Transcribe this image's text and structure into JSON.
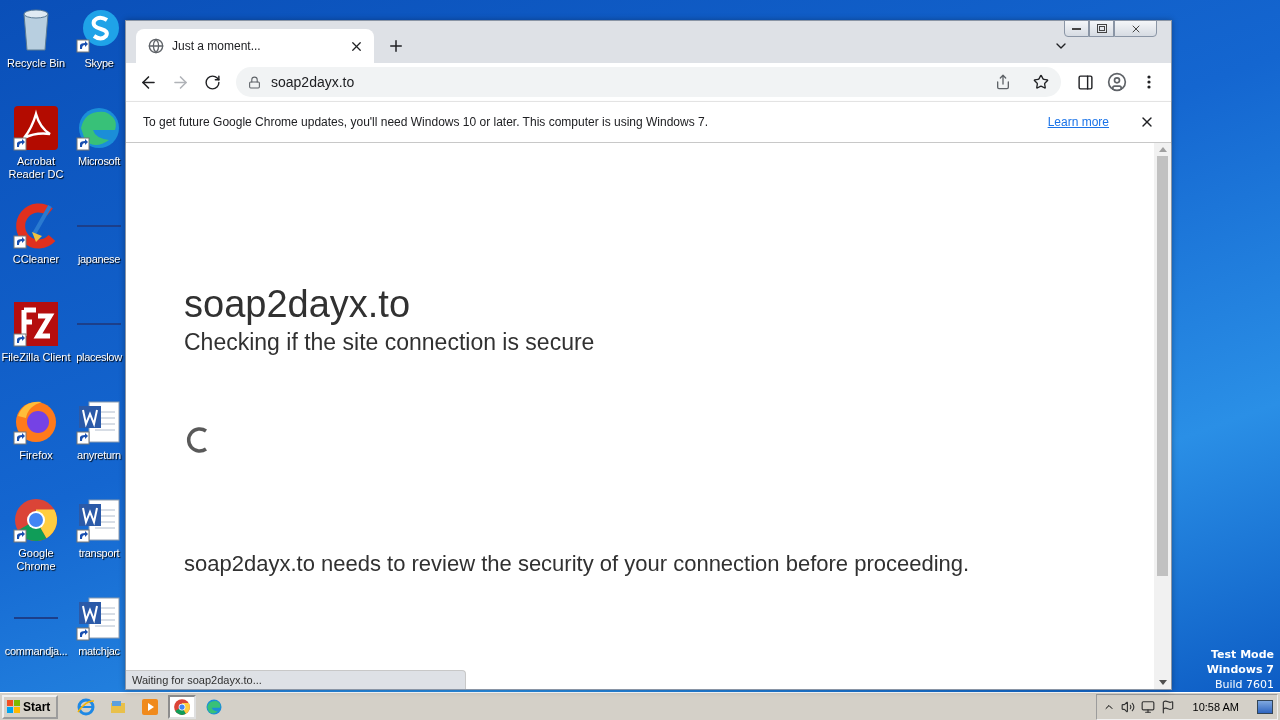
{
  "desktop": {
    "icons": [
      {
        "label": "Recycle Bin",
        "kind": "bin"
      },
      {
        "label": "Skype",
        "kind": "skype"
      },
      {
        "label": "Acrobat Reader DC",
        "kind": "acrobat"
      },
      {
        "label": "Microsoft",
        "kind": "edge"
      },
      {
        "label": "CCleaner",
        "kind": "ccleaner"
      },
      {
        "label": "japanese",
        "kind": "blank"
      },
      {
        "label": "FileZilla Client",
        "kind": "filezilla"
      },
      {
        "label": "placeslow",
        "kind": "blank"
      },
      {
        "label": "Firefox",
        "kind": "firefox"
      },
      {
        "label": "anyreturn",
        "kind": "word"
      },
      {
        "label": "Google Chrome",
        "kind": "chrome"
      },
      {
        "label": "transport",
        "kind": "word"
      },
      {
        "label": "commandja...",
        "kind": "blank"
      },
      {
        "label": "matchjac",
        "kind": "word"
      }
    ],
    "watermark": [
      "Test Mode",
      "Windows 7",
      "Build 7601"
    ]
  },
  "browser": {
    "tab": {
      "title": "Just a moment...",
      "selected": true
    },
    "address": "soap2dayx.to",
    "infobar": {
      "message": "To get future Google Chrome updates, you'll need Windows 10 or later. This computer is using Windows 7.",
      "link": "Learn more"
    },
    "page": {
      "heading": "soap2dayx.to",
      "subheading": "Checking if the site connection is secure",
      "message": "soap2dayx.to needs to review the security of your connection before proceeding."
    },
    "status": "Waiting for soap2dayx.to..."
  },
  "taskbar": {
    "start": "Start",
    "apps": [
      {
        "kind": "ie",
        "selected": false
      },
      {
        "kind": "explorer",
        "selected": false
      },
      {
        "kind": "media",
        "selected": false
      },
      {
        "kind": "chrome",
        "selected": true
      },
      {
        "kind": "edge",
        "selected": false
      }
    ],
    "clock": "10:58 AM"
  }
}
